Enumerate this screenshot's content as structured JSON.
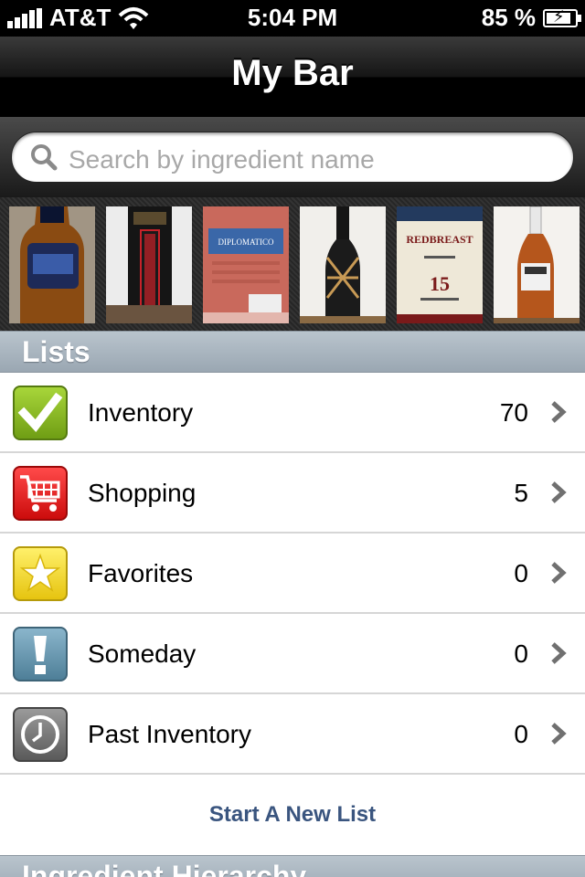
{
  "status_bar": {
    "carrier": "AT&T",
    "time": "5:04 PM",
    "battery": "85 %"
  },
  "nav": {
    "title": "My Bar"
  },
  "search": {
    "placeholder": "Search by ingredient name"
  },
  "bottles": [
    {
      "name": "bottle-1"
    },
    {
      "name": "bottle-2"
    },
    {
      "name": "bottle-3",
      "label": "DIPLOMATICO"
    },
    {
      "name": "bottle-4"
    },
    {
      "name": "bottle-5",
      "label": "REDBREAST",
      "number": "15"
    },
    {
      "name": "bottle-6"
    }
  ],
  "lists_section": {
    "header": "Lists",
    "items": [
      {
        "label": "Inventory",
        "count": "70",
        "icon": "checkmark-icon",
        "color": "#8bbf1e"
      },
      {
        "label": "Shopping",
        "count": "5",
        "icon": "cart-icon",
        "color": "#e01818"
      },
      {
        "label": "Favorites",
        "count": "0",
        "icon": "star-icon",
        "color": "#f1d31c"
      },
      {
        "label": "Someday",
        "count": "0",
        "icon": "exclamation-icon",
        "color": "#5f8fa8"
      },
      {
        "label": "Past Inventory",
        "count": "0",
        "icon": "clock-icon",
        "color": "#777777"
      }
    ],
    "new_list": "Start A New List"
  },
  "ingredient_section": {
    "header": "Ingredient Hierarchy"
  }
}
